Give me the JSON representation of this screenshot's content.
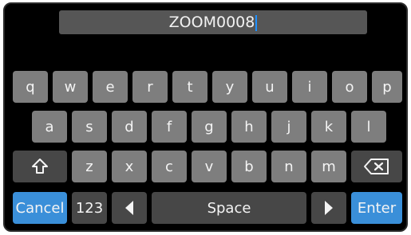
{
  "name_field": {
    "value": "ZOOM0008"
  },
  "keyboard": {
    "row1": [
      "q",
      "w",
      "e",
      "r",
      "t",
      "y",
      "u",
      "i",
      "o",
      "p"
    ],
    "row2": [
      "a",
      "s",
      "d",
      "f",
      "g",
      "h",
      "j",
      "k",
      "l"
    ],
    "row3": [
      "z",
      "x",
      "c",
      "v",
      "b",
      "n",
      "m"
    ],
    "shift_icon": "shift-arrow-icon",
    "backspace_icon": "backspace-icon",
    "cancel_label": "Cancel",
    "numbers_label": "123",
    "left_icon": "left-arrow-icon",
    "space_label": "Space",
    "right_icon": "right-arrow-icon",
    "enter_label": "Enter"
  },
  "colors": {
    "screen_background": "#000000",
    "key": "#7e7e7e",
    "dark_key": "#474747",
    "accent": "#3a8fd9",
    "cursor": "#1e90ff"
  }
}
